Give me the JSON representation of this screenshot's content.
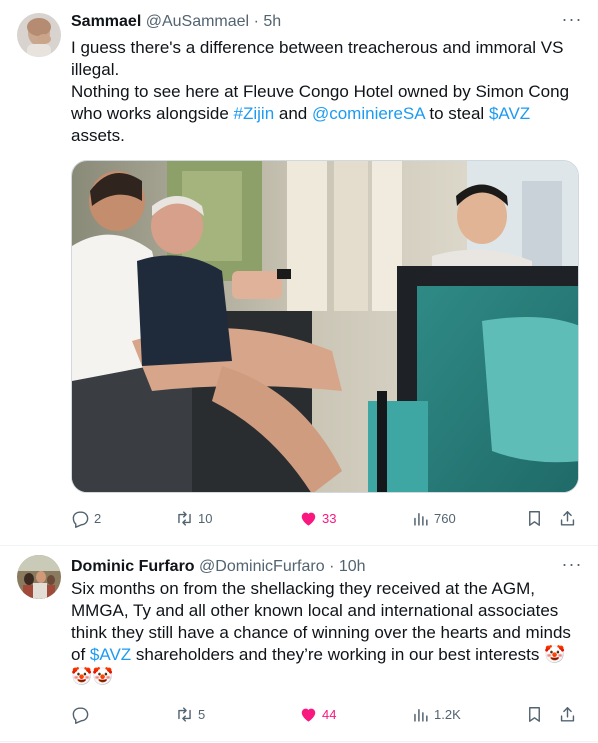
{
  "tweets": [
    {
      "author_name": "Sammael",
      "handle": "@AuSammael",
      "separator": "·",
      "time": "5h",
      "more_label": "···",
      "text": {
        "line1": "I guess there's a difference between treacherous and immoral VS illegal.",
        "line2_a": "Nothing to see here at Fleuve Congo Hotel owned by Simon Cong who works alongside ",
        "link1": "#Zijin",
        "line2_b": " and ",
        "link2": "@cominiereSA",
        "line2_c": " to steal ",
        "link3": "$AVZ",
        "line2_d": " assets."
      },
      "stats": {
        "replies": "2",
        "retweets": "10",
        "likes": "33",
        "views": "760"
      }
    },
    {
      "author_name": "Dominic Furfaro",
      "handle": "@DominicFurfaro",
      "separator": "·",
      "time": "10h",
      "more_label": "···",
      "text": {
        "part_a": "Six months on from the shellacking they received at the AGM, MMGA, Ty and all other known local and international associates think they still have a chance of winning over the hearts and minds of ",
        "link1": "$AVZ",
        "part_b": " shareholders and they’re working in our best interests ",
        "emojis": "🤡🤡🤡"
      },
      "stats": {
        "replies": "",
        "retweets": "5",
        "likes": "44",
        "views": "1.2K"
      }
    }
  ],
  "colors": {
    "link": "#1d9bf0",
    "like_active": "#f91880",
    "secondary_text": "#536471",
    "divider": "#eff3f4"
  },
  "icons": [
    "reply-icon",
    "retweet-icon",
    "like-icon",
    "views-icon",
    "bookmark-icon",
    "share-icon",
    "more-icon"
  ]
}
